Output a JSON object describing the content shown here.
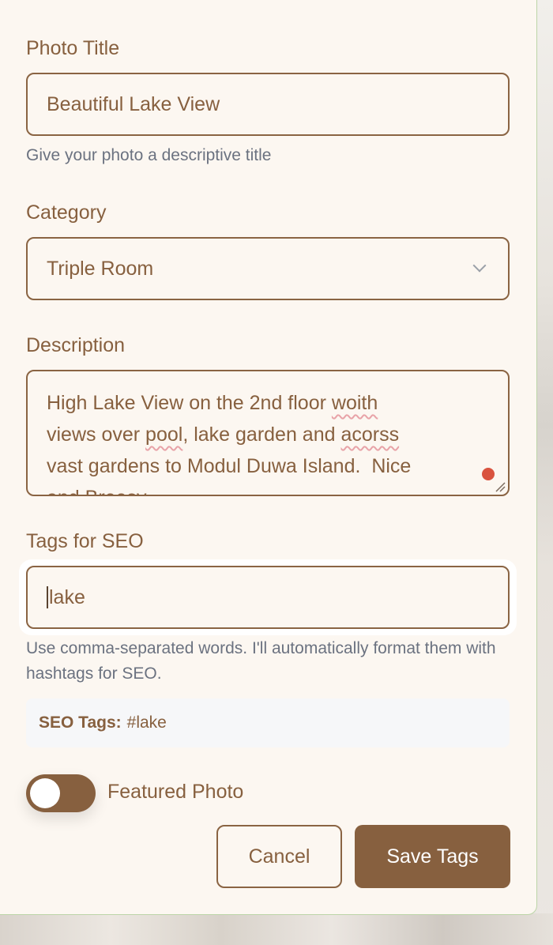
{
  "form": {
    "title": {
      "label": "Photo Title",
      "value": "Beautiful Lake View",
      "hint": "Give your photo a descriptive title"
    },
    "category": {
      "label": "Category",
      "selected": "Triple Room"
    },
    "description": {
      "label": "Description",
      "value_parts": [
        "High Lake View on the 2nd floor ",
        "woith",
        "\nviews over ",
        "pool",
        ", lake garden and ",
        "acorss",
        "\nvast gardens to Modul Duwa Island.  Nice\nand Breesy"
      ]
    },
    "tags": {
      "label": "Tags for SEO",
      "value": "lake",
      "hint": "Use comma-separated words. I'll automatically format them with hashtags for SEO."
    },
    "seo_preview": {
      "label": "SEO Tags:",
      "value": "#lake"
    },
    "featured": {
      "label": "Featured Photo",
      "enabled": false
    }
  },
  "actions": {
    "cancel_label": "Cancel",
    "save_label": "Save Tags"
  },
  "colors": {
    "accent": "#87603f",
    "panel_bg": "#fcf7f1",
    "hint_text": "#6b7280",
    "spellcheck": "#e8a3a8",
    "indicator_dot": "#d9533f"
  }
}
